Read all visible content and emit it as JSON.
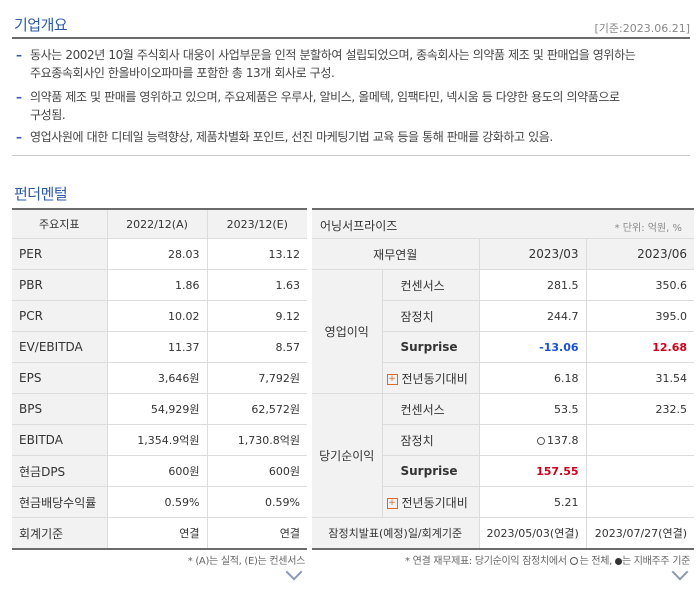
{
  "overview": {
    "title": "기업개요",
    "date_ref": "[기준:2023.06.21]",
    "bullets": [
      "동사는 2002년 10월 주식회사 대웅이 사업부문을 인적 분할하여 설립되었으며, 종속회사는 의약품 제조 및 판매업을 영위하는",
      "주요종속회사인 한올바이오파마를 포함한 총 13개 회사로 구성.",
      "의약품 제조 및 판매를 영위하고 있으며, 주요제품은 우루사, 알비스, 올메텍, 임팩타민, 넥시움 등 다양한 용도의 의약품으로",
      "구성됨.",
      "영업사원에 대한 디테일 능력향상, 제품차별화 포인트, 선진 마케팅기법 교육 등을 통해 판매를 강화하고 있음."
    ]
  },
  "fundamental": {
    "title": "펀더멘털",
    "left_table": {
      "headers": [
        "주요지표",
        "2022/12(A)",
        "2023/12(E)"
      ],
      "rows": [
        [
          "PER",
          "28.03",
          "13.12"
        ],
        [
          "PBR",
          "1.86",
          "1.63"
        ],
        [
          "PCR",
          "10.02",
          "9.12"
        ],
        [
          "EV/EBITDA",
          "11.37",
          "8.57"
        ],
        [
          "EPS",
          "3,646원",
          "7,792원"
        ],
        [
          "BPS",
          "54,929원",
          "62,572원"
        ],
        [
          "EBITDA",
          "1,354.9억원",
          "1,730.8억원"
        ],
        [
          "현금DPS",
          "600원",
          "600원"
        ],
        [
          "현금배당수익률",
          "0.59%",
          "0.59%"
        ],
        [
          "회계기준",
          "연결",
          "연결"
        ]
      ],
      "note": "* (A)는 실적, (E)는 컨센서스"
    },
    "right_table": {
      "title": "어닝서프라이즈",
      "unit": "* 단위: 억원, %",
      "headers": [
        "재무연월",
        "2023/03",
        "2023/06"
      ],
      "groups": [
        {
          "name": "영업이익",
          "rows": [
            {
              "label": "컨센서스",
              "v1": "281.5",
              "v2": "350.6"
            },
            {
              "label": "잠정치",
              "v1": "244.7",
              "v2": "395.0"
            },
            {
              "label": "Surprise",
              "v1": "-13.06",
              "v2": "12.68"
            },
            {
              "label": "전년동기대비",
              "v1": "6.18",
              "v2": "31.54"
            }
          ]
        },
        {
          "name": "당기순이익",
          "rows": [
            {
              "label": "컨센서스",
              "v1": "53.5",
              "v2": "232.5"
            },
            {
              "label": "잠정치",
              "v1": "137.8",
              "v2": ""
            },
            {
              "label": "Surprise",
              "v1": "157.55",
              "v2": ""
            },
            {
              "label": "전년동기대비",
              "v1": "5.21",
              "v2": ""
            }
          ]
        }
      ],
      "footer_label": "잠정치발표(예정)일/회계기준",
      "footer_v1": "2023/05/03(연결)",
      "footer_v2": "2023/07/27(연결)",
      "note_a": "* 연결 재무제표: 당기순이익 잠정치에서 ",
      "note_b": "는 전체, ",
      "note_c": "는 지배주주 기준"
    }
  }
}
